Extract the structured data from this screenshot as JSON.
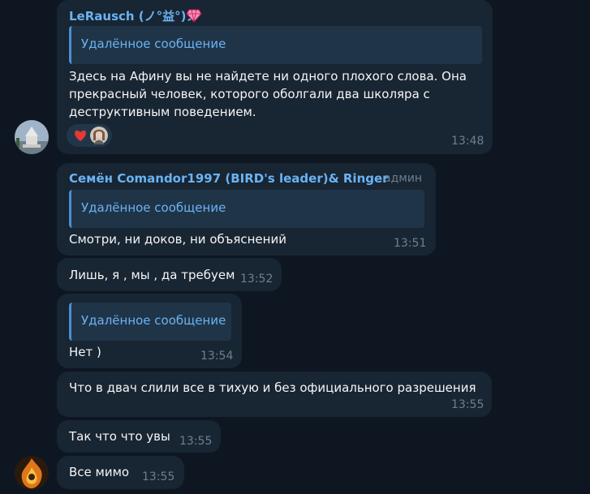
{
  "messages": [
    {
      "author": "LeRausch (ノ°益°)ノ",
      "reply_label": "Удалённое сообщение",
      "lines": [
        "Здесь на Афину вы не найдете ни одного плохого слова. Она",
        "прекрасный человек, которого оболгали два школяра с",
        "деструктивным поведением."
      ],
      "reactions": [
        "heart-emoji",
        "reactor-avatar"
      ],
      "time": "13:48"
    },
    {
      "author": "Семён Comandor1997 (BIRD's leader)& Ringer",
      "role": "админ",
      "reply_label": "Удалённое сообщение",
      "text": "Смотри, ни доков, ни объяснений",
      "time": "13:51"
    },
    {
      "text": "Лишь, я , мы , да требуем",
      "time": "13:52"
    },
    {
      "reply_label": "Удалённое сообщение",
      "text": "Нет )",
      "time": "13:54"
    },
    {
      "text": "Что в двач слили все в тихую и без официального разрешения",
      "time": "13:55"
    },
    {
      "text": "Так что что увы",
      "time": "13:55"
    },
    {
      "text": "Все мимо",
      "time": "13:55"
    }
  ],
  "colors": {
    "background": "#0e1621",
    "bubble": "#182533",
    "accent": "#6ab3f3",
    "heart": "#e53935"
  }
}
